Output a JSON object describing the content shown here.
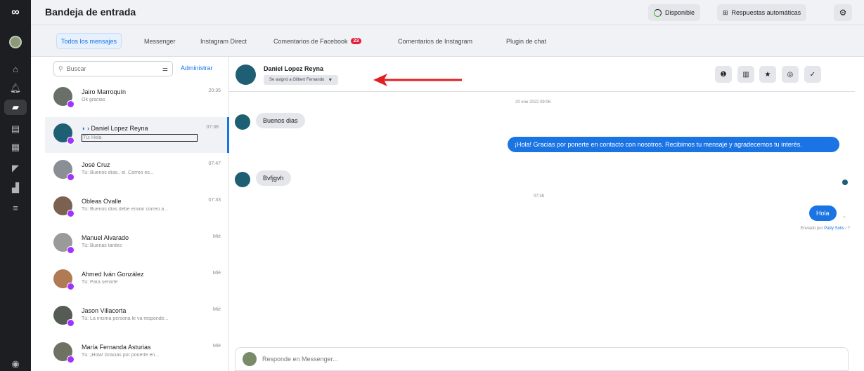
{
  "header": {
    "title": "Bandeja de entrada",
    "status_label": "Disponible",
    "auto_replies_label": "Respuestas automáticas"
  },
  "tabs": [
    {
      "label": "Todos los mensajes",
      "active": true
    },
    {
      "label": "Messenger"
    },
    {
      "label": "Instagram Direct"
    },
    {
      "label": "Comentarios de Facebook",
      "badge": "23"
    },
    {
      "label": "Comentarios de Instagram"
    },
    {
      "label": "Plugin de chat"
    }
  ],
  "list": {
    "search_placeholder": "Buscar",
    "admin_label": "Administrar",
    "conversations": [
      {
        "name": "Jairo Marroquín",
        "preview": "Ok gracias",
        "time": "20:35"
      },
      {
        "name": "Daniel Lopez Reyna",
        "preview": "Tú: Hola",
        "time": "07:38",
        "selected": true
      },
      {
        "name": "José Cruz",
        "preview": "Tú: Buenos días.. el. Correo es...",
        "time": "07:47"
      },
      {
        "name": "Obleas Ovalle",
        "preview": "Tú: Buenos días debe enviar correo a...",
        "time": "07:33"
      },
      {
        "name": "Manuel Alvarado",
        "preview": "Tú: Buenas tardes",
        "time": "Mié"
      },
      {
        "name": "Ahmed Iván González",
        "preview": "Tú: Para servirle",
        "time": "Mié"
      },
      {
        "name": "Jason Villacorta",
        "preview": "Tú: La misma persona le va responde...",
        "time": "Mié"
      },
      {
        "name": "María Fernanda Asturias",
        "preview": "Tú: ¡Hola! Gracias por ponerte en...",
        "time": "Mié"
      }
    ]
  },
  "chat": {
    "contact_name": "Daniel Lopez Reyna",
    "assigned_label": "Se asignó a Gilbert Fernando",
    "date_stamp": "20 ene 2022 09:06",
    "time_stamp": "07:38",
    "messages": [
      {
        "from": "in",
        "text": "Buenos dias"
      },
      {
        "from": "out",
        "text": "¡Hola! Gracias por ponerte en contacto con nosotros. Recibimos tu mensaje y agradecemos tu interés."
      },
      {
        "from": "in",
        "text": "Bvfjgvh"
      },
      {
        "from": "out",
        "text": "Hola"
      }
    ],
    "sent_by_prefix": "Enviado por",
    "sent_by_name": "Patty Solis",
    "sent_by_suffix": "/ ?",
    "composer_placeholder": "Responde en Messenger..."
  },
  "colors": {
    "accent": "#1b74e4",
    "rail": "#1c1e21",
    "badge": "#e41e3f",
    "arrow": "#e02020"
  },
  "icons": [
    "meta-logo-icon",
    "home-icon",
    "notification-icon",
    "inbox-icon",
    "ads-icon",
    "planner-icon",
    "megaphone-icon",
    "insights-icon",
    "menu-icon",
    "search-icon",
    "filter-icon",
    "messenger-badge-icon",
    "info-icon",
    "trash-icon",
    "star-icon",
    "eye-icon",
    "check-icon",
    "chevron-down-icon",
    "gear-icon"
  ]
}
